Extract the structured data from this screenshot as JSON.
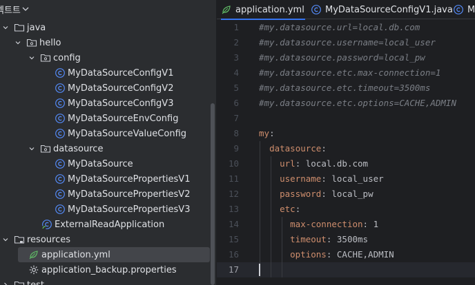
{
  "panel": {
    "title": "젝트트"
  },
  "tree": [
    {
      "label": "java",
      "icon": "folder-icon"
    },
    {
      "label": "hello",
      "icon": "package-icon"
    },
    {
      "label": "config",
      "icon": "package-icon"
    },
    {
      "label": "MyDataSourceConfigV1",
      "icon": "class-icon"
    },
    {
      "label": "MyDataSourceConfigV2",
      "icon": "class-icon"
    },
    {
      "label": "MyDataSourceConfigV3",
      "icon": "class-icon"
    },
    {
      "label": "MyDataSourceEnvConfig",
      "icon": "class-icon"
    },
    {
      "label": "MyDataSourceValueConfig",
      "icon": "class-icon"
    },
    {
      "label": "datasource",
      "icon": "package-icon"
    },
    {
      "label": "MyDataSource",
      "icon": "class-icon"
    },
    {
      "label": "MyDataSourcePropertiesV1",
      "icon": "class-icon"
    },
    {
      "label": "MyDataSourcePropertiesV2",
      "icon": "class-icon"
    },
    {
      "label": "MyDataSourcePropertiesV3",
      "icon": "class-icon"
    },
    {
      "label": "ExternalReadApplication",
      "icon": "spring-class-icon"
    },
    {
      "label": "resources",
      "icon": "resources-folder-icon"
    },
    {
      "label": "application.yml",
      "icon": "yaml-icon"
    },
    {
      "label": "application_backup.properties",
      "icon": "properties-icon"
    },
    {
      "label": "test",
      "icon": "folder-icon"
    }
  ],
  "tabs": [
    {
      "label": "application.yml",
      "icon": "yaml-icon",
      "active": true
    },
    {
      "label": "MyDataSourceConfigV1.java",
      "icon": "class-icon",
      "active": false
    },
    {
      "label": "My",
      "icon": "class-icon",
      "active": false
    }
  ],
  "editor": {
    "line_numbers": [
      "1",
      "2",
      "3",
      "4",
      "5",
      "6",
      "7",
      "8",
      "9",
      "10",
      "11",
      "12",
      "13",
      "14",
      "15",
      "16",
      "17"
    ],
    "current_line": "17",
    "lines": [
      {
        "c": "#my.datasource.url=local.db.com"
      },
      {
        "c": "#my.datasource.username=local_user"
      },
      {
        "c": "#my.datasource.password=local_pw"
      },
      {
        "c": "#my.datasource.etc.max-connection=1"
      },
      {
        "c": "#my.datasource.etc.timeout=3500ms"
      },
      {
        "c": "#my.datasource.etc.options=CACHE,ADMIN"
      },
      {},
      {
        "k": "my",
        "indent": ""
      },
      {
        "k": "datasource",
        "indent": "  "
      },
      {
        "k": "url",
        "v": "local.db.com",
        "indent": "    "
      },
      {
        "k": "username",
        "v": "local_user",
        "indent": "    "
      },
      {
        "k": "password",
        "v": "local_pw",
        "indent": "    "
      },
      {
        "k": "etc",
        "indent": "    "
      },
      {
        "k": "max-connection",
        "v": "1",
        "indent": "      "
      },
      {
        "k": "timeout",
        "v": "3500ms",
        "indent": "      "
      },
      {
        "k": "options",
        "v": "CACHE,ADMIN",
        "indent": "      "
      },
      {}
    ]
  },
  "colors": {
    "accent": "#3574f0",
    "comment": "#7a7e85",
    "yaml_key": "#cf8e6d",
    "text": "#bcbec4",
    "panel_bg": "#2b2d30",
    "editor_bg": "#1e1f22"
  }
}
